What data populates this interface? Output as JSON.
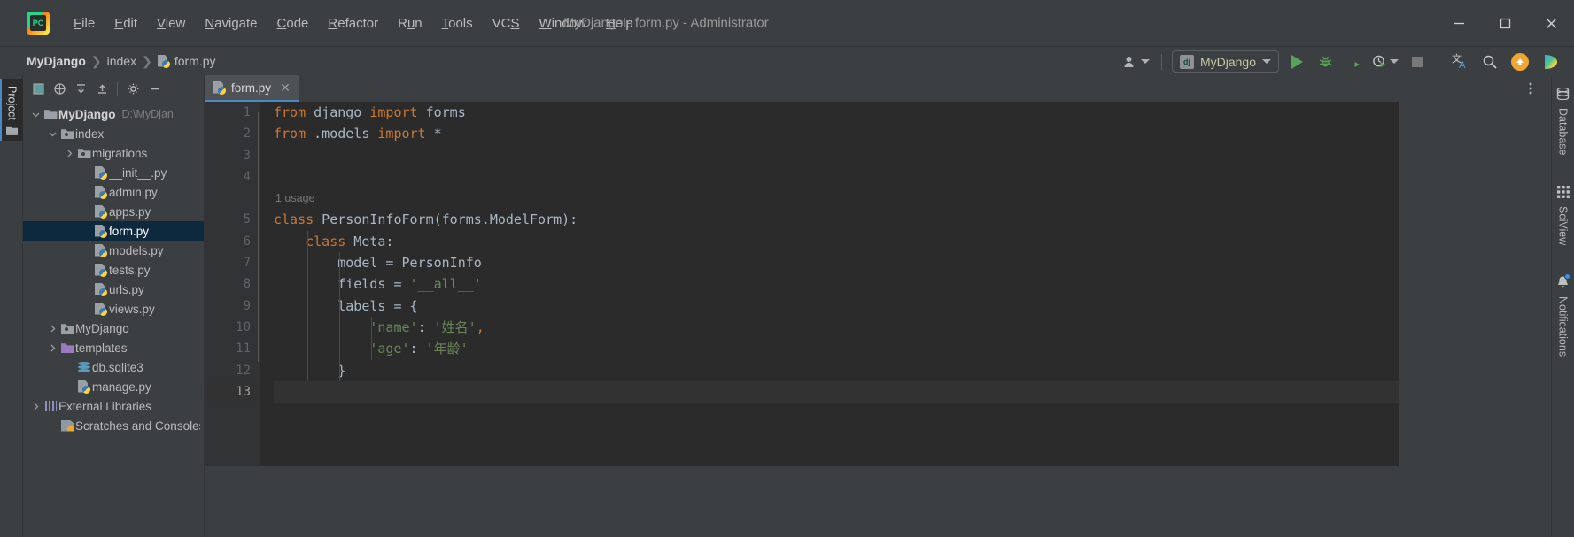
{
  "window": {
    "title": "MyDjango - form.py - Administrator",
    "logo": "pycharm-logo",
    "controls": {
      "minimize": "–",
      "maximize": "□",
      "close": "✕"
    }
  },
  "menu": [
    {
      "label": "File",
      "mnemonic": "F"
    },
    {
      "label": "Edit",
      "mnemonic": "E"
    },
    {
      "label": "View",
      "mnemonic": "V"
    },
    {
      "label": "Navigate",
      "mnemonic": "N"
    },
    {
      "label": "Code",
      "mnemonic": "C"
    },
    {
      "label": "Refactor",
      "mnemonic": "R"
    },
    {
      "label": "Run",
      "mnemonic": "u"
    },
    {
      "label": "Tools",
      "mnemonic": "T"
    },
    {
      "label": "VCS",
      "mnemonic": "S"
    },
    {
      "label": "Window",
      "mnemonic": "W"
    },
    {
      "label": "Help",
      "mnemonic": "H"
    }
  ],
  "breadcrumb": {
    "items": [
      {
        "label": "MyDjango",
        "icon": "none"
      },
      {
        "label": "index",
        "icon": "none"
      },
      {
        "label": "form.py",
        "icon": "python-file-icon"
      }
    ],
    "separator": "❯"
  },
  "toolbar": {
    "account_label": "account-icon",
    "run_config": {
      "name": "MyDjango",
      "icon": "django-icon"
    },
    "buttons": [
      {
        "name": "run-button",
        "icon": "play-icon"
      },
      {
        "name": "debug-button",
        "icon": "bug-icon"
      },
      {
        "name": "run-with-coverage-button",
        "icon": "coverage-icon"
      },
      {
        "name": "profile-button",
        "icon": "profiler-icon"
      },
      {
        "name": "stop-button",
        "icon": "stop-icon"
      },
      {
        "name": "translate-button",
        "icon": "translate-icon"
      },
      {
        "name": "search-everywhere-button",
        "icon": "search-icon"
      },
      {
        "name": "update-button",
        "icon": "up-arrow-icon"
      },
      {
        "name": "ide-feature-button",
        "icon": "colorful-play-icon"
      }
    ]
  },
  "left_strip": {
    "project_tab": "Project"
  },
  "right_strip": {
    "tabs": [
      {
        "label": "Database",
        "icon": "database-icon"
      },
      {
        "label": "SciView",
        "icon": "grid-icon"
      },
      {
        "label": "Notifications",
        "icon": "bell-icon",
        "badge": true
      }
    ]
  },
  "project_panel": {
    "toolbar_buttons": [
      {
        "name": "select-opened-file-button",
        "icon": "square-icon"
      },
      {
        "name": "scroll-from-source-button",
        "icon": "target-icon"
      },
      {
        "name": "expand-all-button",
        "icon": "expand-icon"
      },
      {
        "name": "collapse-all-button",
        "icon": "collapse-icon"
      },
      {
        "name": "settings-button",
        "icon": "gear-icon"
      },
      {
        "name": "hide-button",
        "icon": "minus-icon"
      }
    ],
    "tree": [
      {
        "label": "MyDjango",
        "path": "D:\\MyDjan",
        "icon": "folder-icon",
        "indent": 0,
        "arrow": "down",
        "bold": true,
        "selected": false
      },
      {
        "label": "index",
        "path": "",
        "icon": "source-folder-icon",
        "indent": 1,
        "arrow": "down",
        "bold": false,
        "selected": false
      },
      {
        "label": "migrations",
        "path": "",
        "icon": "source-folder-icon",
        "indent": 2,
        "arrow": "right",
        "bold": false,
        "selected": false
      },
      {
        "label": "__init__.py",
        "path": "",
        "icon": "python-file-icon",
        "indent": 3,
        "arrow": "none",
        "bold": false,
        "selected": false
      },
      {
        "label": "admin.py",
        "path": "",
        "icon": "python-file-icon",
        "indent": 3,
        "arrow": "none",
        "bold": false,
        "selected": false
      },
      {
        "label": "apps.py",
        "path": "",
        "icon": "python-file-icon",
        "indent": 3,
        "arrow": "none",
        "bold": false,
        "selected": false
      },
      {
        "label": "form.py",
        "path": "",
        "icon": "python-file-icon",
        "indent": 3,
        "arrow": "none",
        "bold": false,
        "selected": true
      },
      {
        "label": "models.py",
        "path": "",
        "icon": "python-file-icon",
        "indent": 3,
        "arrow": "none",
        "bold": false,
        "selected": false
      },
      {
        "label": "tests.py",
        "path": "",
        "icon": "python-file-icon",
        "indent": 3,
        "arrow": "none",
        "bold": false,
        "selected": false
      },
      {
        "label": "urls.py",
        "path": "",
        "icon": "python-file-icon",
        "indent": 3,
        "arrow": "none",
        "bold": false,
        "selected": false
      },
      {
        "label": "views.py",
        "path": "",
        "icon": "python-file-icon",
        "indent": 3,
        "arrow": "none",
        "bold": false,
        "selected": false
      },
      {
        "label": "MyDjango",
        "path": "",
        "icon": "source-folder-icon",
        "indent": 1,
        "arrow": "right",
        "bold": false,
        "selected": false
      },
      {
        "label": "templates",
        "path": "",
        "icon": "templates-folder-icon",
        "indent": 1,
        "arrow": "right",
        "bold": false,
        "selected": false
      },
      {
        "label": "db.sqlite3",
        "path": "",
        "icon": "database-file-icon",
        "indent": 2,
        "arrow": "none",
        "bold": false,
        "selected": false
      },
      {
        "label": "manage.py",
        "path": "",
        "icon": "python-file-icon",
        "indent": 2,
        "arrow": "none",
        "bold": false,
        "selected": false
      },
      {
        "label": "External Libraries",
        "path": "",
        "icon": "library-icon",
        "indent": 0,
        "arrow": "right",
        "bold": false,
        "selected": false
      },
      {
        "label": "Scratches and Consoles",
        "path": "",
        "icon": "scratches-icon",
        "indent": 1,
        "arrow": "none",
        "bold": false,
        "selected": false
      }
    ]
  },
  "editor": {
    "tab": {
      "label": "form.py",
      "icon": "python-file-icon",
      "close": "✕"
    },
    "options_icon": "more-options-icon",
    "inspection_status": "✔",
    "usage_hint": "1 usage",
    "line_numbers": [
      "1",
      "2",
      "3",
      "4",
      "5",
      "6",
      "7",
      "8",
      "9",
      "10",
      "11",
      "12",
      "13"
    ],
    "current_line": 13,
    "code_lines": [
      {
        "n": 1,
        "tokens": [
          {
            "t": "from",
            "c": "kw"
          },
          {
            "t": " django ",
            "c": "ident"
          },
          {
            "t": "import",
            "c": "kw"
          },
          {
            "t": " forms",
            "c": "ident"
          }
        ]
      },
      {
        "n": 2,
        "tokens": [
          {
            "t": "from",
            "c": "kw"
          },
          {
            "t": " .models ",
            "c": "ident"
          },
          {
            "t": "import",
            "c": "kw"
          },
          {
            "t": " *",
            "c": "ident"
          }
        ]
      },
      {
        "n": 3,
        "tokens": []
      },
      {
        "n": 4,
        "tokens": []
      },
      {
        "n": 5,
        "tokens": [
          {
            "t": "class",
            "c": "kw"
          },
          {
            "t": " PersonInfoForm(forms.ModelForm):",
            "c": "ident"
          }
        ]
      },
      {
        "n": 6,
        "tokens": [
          {
            "t": "    ",
            "c": "ident"
          },
          {
            "t": "class",
            "c": "kw"
          },
          {
            "t": " Meta:",
            "c": "ident"
          }
        ]
      },
      {
        "n": 7,
        "tokens": [
          {
            "t": "        model = PersonInfo",
            "c": "ident"
          }
        ]
      },
      {
        "n": 8,
        "tokens": [
          {
            "t": "        fields = ",
            "c": "ident"
          },
          {
            "t": "'__all__'",
            "c": "str"
          }
        ]
      },
      {
        "n": 9,
        "tokens": [
          {
            "t": "        labels = {",
            "c": "ident"
          }
        ]
      },
      {
        "n": 10,
        "tokens": [
          {
            "t": "            ",
            "c": "ident"
          },
          {
            "t": "'name'",
            "c": "str"
          },
          {
            "t": ": ",
            "c": "ident"
          },
          {
            "t": "'姓名'",
            "c": "str"
          },
          {
            "t": ",",
            "c": "kw"
          }
        ]
      },
      {
        "n": 11,
        "tokens": [
          {
            "t": "            ",
            "c": "ident"
          },
          {
            "t": "'age'",
            "c": "str"
          },
          {
            "t": ": ",
            "c": "ident"
          },
          {
            "t": "'年龄'",
            "c": "str"
          }
        ]
      },
      {
        "n": 12,
        "tokens": [
          {
            "t": "        }",
            "c": "ident"
          }
        ]
      },
      {
        "n": 13,
        "tokens": []
      }
    ],
    "fold_markers": [
      1,
      2,
      5,
      6,
      9,
      12
    ]
  },
  "colors": {
    "background": "#3c3f41",
    "editor_background": "#2b2b2b",
    "keyword": "#cc7832",
    "string": "#6a8759",
    "identifier": "#a9b7c6",
    "selection": "#0d293e",
    "accent": "#4a88c7",
    "run_green": "#5aa15a"
  }
}
